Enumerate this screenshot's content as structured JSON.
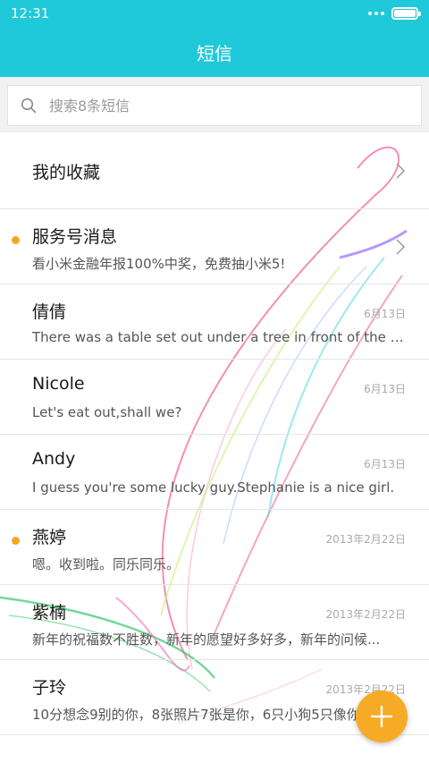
{
  "status_bar": {
    "time": "12:31"
  },
  "header": {
    "title": "短信"
  },
  "search": {
    "placeholder": "搜索8条短信"
  },
  "favorites": {
    "label": "我的收藏"
  },
  "conversations": [
    {
      "name": "服务号消息",
      "preview": "看小米金融年报100%中奖，免费抽小米5!",
      "date": "",
      "unread": true,
      "chevron": true
    },
    {
      "name": "倩倩",
      "preview": "There was a table set out under a tree in front of the house...",
      "date": "6月13日",
      "unread": false
    },
    {
      "name": "Nicole",
      "preview": "Let's eat out,shall we?",
      "date": "6月13日",
      "unread": false
    },
    {
      "name": "Andy",
      "preview": "I guess you're some lucky guy.Stephanie is a nice girl.",
      "date": "6月13日",
      "unread": false
    },
    {
      "name": "燕婷",
      "preview": "嗯。收到啦。同乐同乐。",
      "date": "2013年2月22日",
      "unread": true
    },
    {
      "name": "紫楠",
      "preview": "新年的祝福数不胜数，新年的愿望好多好多，新年的问候...",
      "date": "2013年2月22日",
      "unread": false
    },
    {
      "name": "子玲",
      "preview": "10分想念9别的你，8张照片7张是你，6只小狗5只像你...",
      "date": "2013年2月22日",
      "unread": false
    }
  ],
  "colors": {
    "accent": "#1fc9d9",
    "fab": "#f6aa26",
    "unread_dot": "#f5a623"
  },
  "icons": {
    "search": "search-icon",
    "chevron": "chevron-right-icon",
    "fab": "plus-icon"
  }
}
